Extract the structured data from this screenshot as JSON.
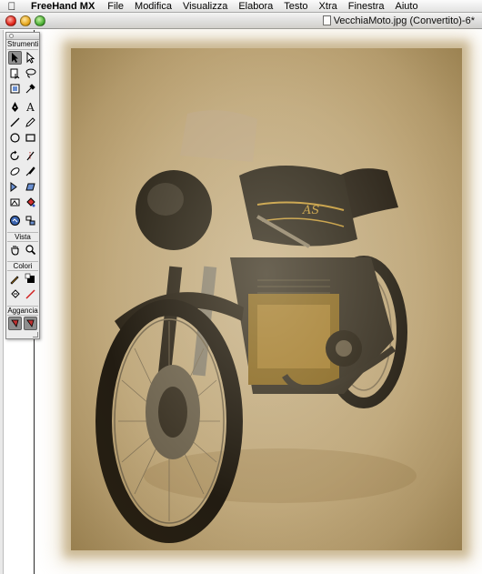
{
  "menubar": {
    "apple_icon": "apple-logo-icon",
    "app_name": "FreeHand MX",
    "items": [
      "File",
      "Modifica",
      "Visualizza",
      "Elabora",
      "Testo",
      "Xtra",
      "Finestra",
      "Aiuto"
    ]
  },
  "window": {
    "title": "VecchiaMoto.jpg (Convertito)-6*"
  },
  "tools_panel": {
    "sections": {
      "tools_label": "Strumenti",
      "view_label": "Vista",
      "colors_label": "Colori",
      "snap_label": "Aggancia"
    },
    "tools": [
      [
        "pointer-tool",
        "subselect-tool"
      ],
      [
        "page-tool",
        "lasso-tool"
      ],
      [
        "scale-tool",
        "eyedropper-tool"
      ],
      [
        "pen-tool",
        "text-tool"
      ],
      [
        "line-tool",
        "pencil-tool"
      ],
      [
        "ellipse-tool",
        "rectangle-tool"
      ],
      [
        "rotate-tool",
        "knife-tool"
      ],
      [
        "eraser-tool",
        "brush-tool"
      ],
      [
        "reflect-tool",
        "skew-tool"
      ],
      [
        "trace-tool",
        "paint-bucket-tool"
      ],
      [
        "chart-tool",
        "graphic-hose-tool"
      ]
    ],
    "view_tools": [
      "hand-tool",
      "zoom-tool"
    ],
    "color_tools": [
      "stroke-color-tool",
      "fill-color-tool"
    ],
    "color_tools_2": [
      "swap-colors-tool",
      "default-colors-tool"
    ],
    "snap_tools": [
      "snap-to-point-tool",
      "snap-to-object-tool"
    ]
  },
  "colors": {
    "sepia_photo": "#c0a97d",
    "selected_tool": "#8e8e8e",
    "panel_bg": "#ececec"
  }
}
